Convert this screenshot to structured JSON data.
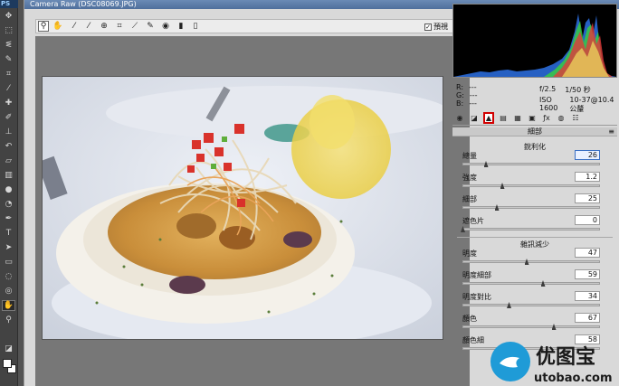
{
  "app": {
    "ps_logo": "PS",
    "window_title": "Camera Raw (DSC08069.JPG)"
  },
  "toolbar": {
    "tools": [
      "zoom-icon",
      "hand-icon",
      "white-balance-icon",
      "color-sampler-icon",
      "target-adjust-icon",
      "crop-icon",
      "straighten-icon",
      "spot-removal-icon",
      "red-eye-icon",
      "adjustment-brush-icon",
      "graduated-filter-icon"
    ],
    "preview_label": "預視",
    "preview_checked": true
  },
  "info": {
    "r_label": "R:",
    "r_value": "---",
    "g_label": "G:",
    "g_value": "---",
    "b_label": "B:",
    "b_value": "---",
    "aperture": "f/2.5",
    "shutter": "1/50 秒",
    "iso": "ISO 1600",
    "lens": "10-37@10.4 公釐"
  },
  "panel": {
    "title": "細部",
    "active_tab": "detail",
    "tabs": [
      "basic",
      "tone-curve",
      "detail",
      "hsl",
      "split-toning",
      "lens-corrections",
      "fx",
      "camera-calibration",
      "presets"
    ]
  },
  "sharpening": {
    "title": "銳利化",
    "sliders": [
      {
        "label": "總量",
        "value": "26",
        "fraction": 0.17,
        "focused": true
      },
      {
        "label": "強度",
        "value": "1.2",
        "fraction": 0.29
      },
      {
        "label": "細部",
        "value": "25",
        "fraction": 0.25
      },
      {
        "label": "遮色片",
        "value": "0",
        "fraction": 0.0
      }
    ]
  },
  "noise_reduction": {
    "title": "雜訊減少",
    "sliders": [
      {
        "label": "明度",
        "value": "47",
        "fraction": 0.47
      },
      {
        "label": "明度細部",
        "value": "59",
        "fraction": 0.59
      },
      {
        "label": "明度對比",
        "value": "34",
        "fraction": 0.34
      },
      {
        "label": "顏色",
        "value": "67",
        "fraction": 0.67
      },
      {
        "label": "顏色細",
        "value": "58",
        "fraction": 0.58
      }
    ]
  },
  "watermark": {
    "brand_cn": "优图宝",
    "brand_url": "utobao.com"
  },
  "colors": {
    "active_tab_border": "#d10000",
    "histogram_bg": "#000000"
  }
}
